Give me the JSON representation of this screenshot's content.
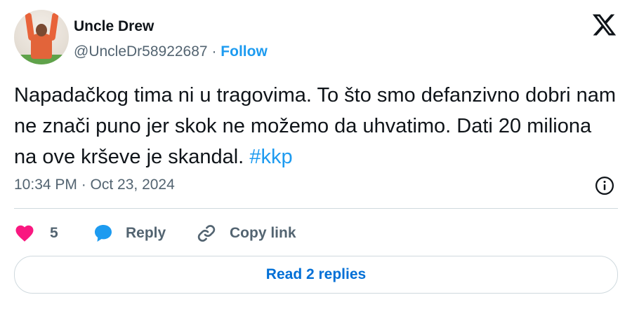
{
  "author": {
    "name": "Uncle Drew",
    "handle": "@UncleDr58922687",
    "separator": "·",
    "follow_label": "Follow"
  },
  "tweet": {
    "text": "Napadačkog tima ni u tragovima. To što smo defanzivno dobri nam ne znači puno jer skok ne možemo da uhvatimo. Dati 20 miliona na ove krševe je skandal.",
    "hashtag": "#kkp",
    "timestamp": "10:34 PM · Oct 23, 2024"
  },
  "actions": {
    "like_count": "5",
    "reply_label": "Reply",
    "copy_label": "Copy link"
  },
  "read_replies_label": "Read 2 replies",
  "icons": {
    "brand": "x-logo-icon",
    "info": "info-icon",
    "like": "heart-icon",
    "reply": "speech-bubble-icon",
    "copy": "link-icon"
  },
  "colors": {
    "text_primary": "#0f1419",
    "text_secondary": "#536471",
    "accent": "#1d9bf0",
    "like": "#f91880",
    "reply": "#1d9bf0",
    "read_button_text": "#006fd6",
    "divider": "#cfd9de"
  }
}
